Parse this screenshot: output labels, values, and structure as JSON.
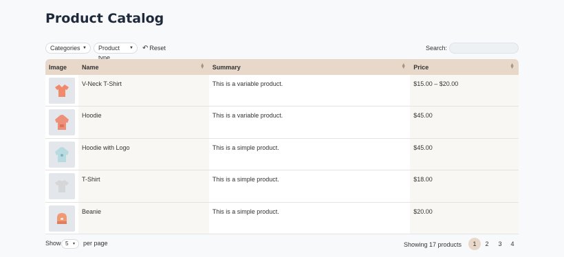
{
  "page": {
    "title": "Product Catalog"
  },
  "toolbar": {
    "categories_label": "Categories",
    "product_type_label": "Product type",
    "reset_label": "Reset",
    "search_label": "Search:",
    "search_value": "",
    "search_placeholder": ""
  },
  "table": {
    "headers": {
      "image": "Image",
      "name": "Name",
      "summary": "Summary",
      "price": "Price"
    },
    "rows": [
      {
        "image_icon": "vneck-tshirt-icon",
        "image_color": "#f08a6a",
        "name": "V-Neck T-Shirt",
        "summary": "This is a variable product.",
        "price": "$15.00 – $20.00"
      },
      {
        "image_icon": "hoodie-icon",
        "image_color": "#ee8f7a",
        "name": "Hoodie",
        "summary": "This is a variable product.",
        "price": "$45.00"
      },
      {
        "image_icon": "hoodie-logo-icon",
        "image_color": "#b7dbe0",
        "name": "Hoodie with Logo",
        "summary": "This is a simple product.",
        "price": "$45.00"
      },
      {
        "image_icon": "tshirt-icon",
        "image_color": "#d4d6d8",
        "name": "T-Shirt",
        "summary": "This is a simple product.",
        "price": "$18.00"
      },
      {
        "image_icon": "beanie-icon",
        "image_color": "#f09a74",
        "name": "Beanie",
        "summary": "This is a simple product.",
        "price": "$20.00"
      }
    ]
  },
  "footer": {
    "show_label": "Show",
    "per_page_value": "5",
    "per_page_label": "per page",
    "count_label": "Showing 17 products",
    "pages": [
      "1",
      "2",
      "3",
      "4"
    ],
    "active_page": "1"
  },
  "colors": {
    "header_bg": "#e8d8c9",
    "active_page_bg": "#e8d8c9",
    "title_color": "#1e2a3b"
  }
}
